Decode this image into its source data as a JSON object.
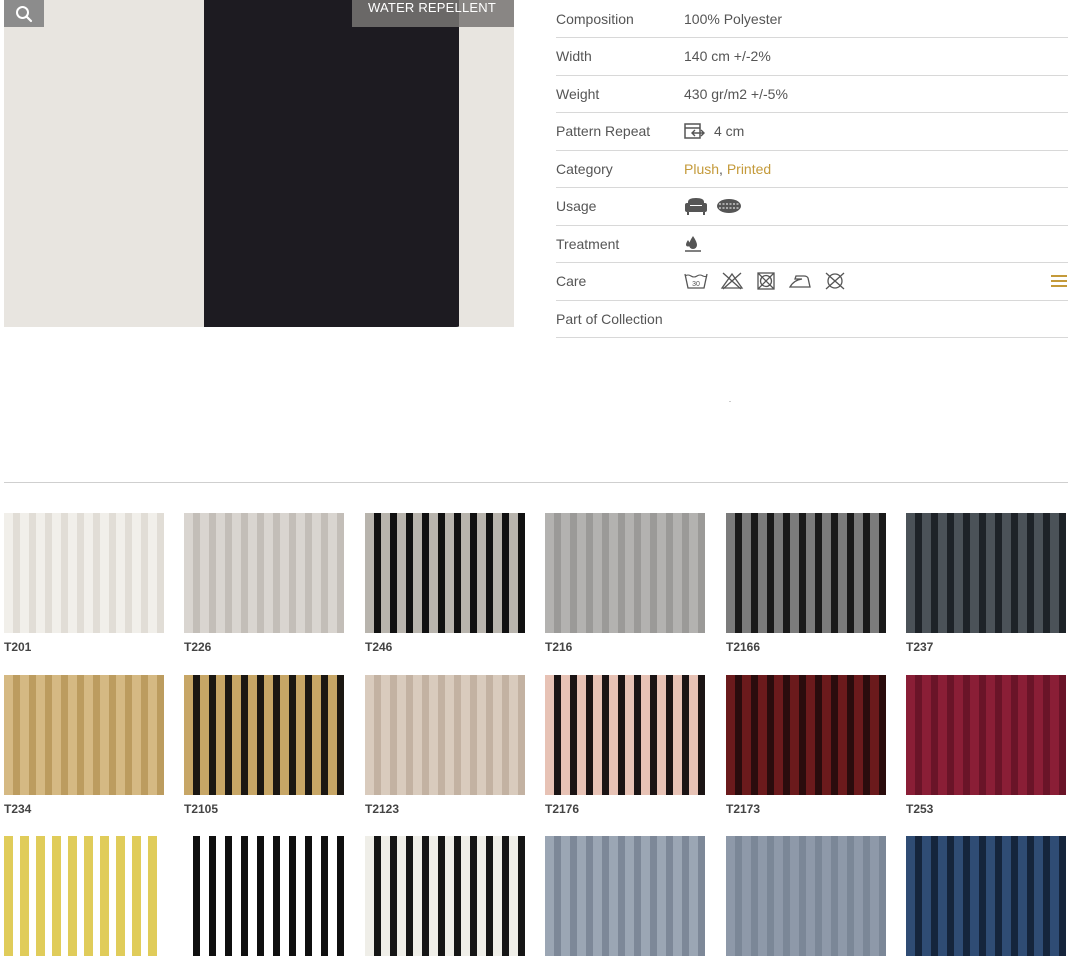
{
  "hero": {
    "badge": "WATER REPELLENT",
    "colors": {
      "light": "#e8e5e0",
      "dark": "#1d1b21"
    }
  },
  "specs": [
    {
      "label": "Composition",
      "value": "100% Polyester"
    },
    {
      "label": "Width",
      "value": "140 cm +/-2%"
    },
    {
      "label": "Weight",
      "value": "430 gr/m2 +/-5%"
    },
    {
      "label": "Pattern Repeat",
      "value": "4 cm",
      "icon": "pattern-repeat-icon"
    },
    {
      "label": "Category",
      "links": [
        "Plush",
        "Printed"
      ],
      "separator": ", "
    },
    {
      "label": "Usage",
      "icons": [
        "armchair-icon",
        "cushion-icon"
      ]
    },
    {
      "label": "Treatment",
      "icons": [
        "water-repellent-icon"
      ]
    },
    {
      "label": "Care",
      "icons": [
        "wash-30-icon",
        "no-bleach-icon",
        "no-tumble-dry-icon",
        "iron-low-icon",
        "no-dry-clean-icon"
      ],
      "extra_icon": "menu-icon"
    },
    {
      "label": "Part of Collection",
      "value": ""
    }
  ],
  "accent_color": "#c49a3a",
  "swatches": [
    {
      "code": "T201",
      "a": "#f1efea",
      "b": "#e1ddd6"
    },
    {
      "code": "T226",
      "a": "#d9d5d0",
      "b": "#c3beb8"
    },
    {
      "code": "T246",
      "a": "#b8b4ad",
      "b": "#111111"
    },
    {
      "code": "T216",
      "a": "#b3b2b0",
      "b": "#9b9a98"
    },
    {
      "code": "T2166",
      "a": "#7b7b7b",
      "b": "#1a1a1a"
    },
    {
      "code": "T237",
      "a": "#4b5258",
      "b": "#1e2328"
    },
    {
      "code": "T234",
      "a": "#d5b983",
      "b": "#bc9c5f"
    },
    {
      "code": "T2105",
      "a": "#c7a666",
      "b": "#1b1712"
    },
    {
      "code": "T2123",
      "a": "#d9cbbd",
      "b": "#c3b2a2"
    },
    {
      "code": "T2176",
      "a": "#e7c2b5",
      "b": "#1b1414"
    },
    {
      "code": "T2173",
      "a": "#6b1a1c",
      "b": "#2a0c0d"
    },
    {
      "code": "T253",
      "a": "#8a1e36",
      "b": "#6a1428"
    },
    {
      "code": "",
      "a": "#e0cc5a",
      "b": "#ffffff"
    },
    {
      "code": "",
      "a": "#ffffff",
      "b": "#0f0f0f"
    },
    {
      "code": "",
      "a": "#efeee8",
      "b": "#151515"
    },
    {
      "code": "",
      "a": "#9ba6b4",
      "b": "#7d8898"
    },
    {
      "code": "",
      "a": "#8e99a9",
      "b": "#7b8797"
    },
    {
      "code": "",
      "a": "#2f4c74",
      "b": "#15253c"
    }
  ]
}
